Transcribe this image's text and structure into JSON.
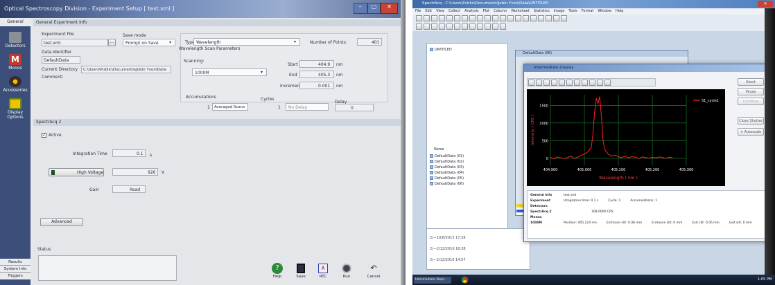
{
  "left": {
    "window_title": "Optical Spectroscopy Division - Experiment Setup [ test.xml ]",
    "window_controls": [
      "–",
      "▢",
      "✕"
    ],
    "side_tabs_top": "General",
    "side_items": [
      {
        "label": "Detectors",
        "icon": "detector-icon",
        "color": "#8b9098"
      },
      {
        "label": "Monos",
        "icon": "monochromator-icon",
        "color": "#c0392b"
      },
      {
        "label": "Accessories",
        "icon": "accessories-icon",
        "color": "#3d2a2a"
      },
      {
        "label": "Display Options",
        "icon": "display-options-icon",
        "color": "#6a8e1f"
      }
    ],
    "side_tabs_bottom": [
      "Results",
      "System Info",
      "Triggers"
    ],
    "section_general": "General Experiment Info",
    "experiment_file_label": "Experiment File",
    "experiment_file_value": "test.xml",
    "browse_label": "...",
    "save_mode_label": "Save mode",
    "save_mode_value": "Prompt on Save",
    "data_identifier_label": "Data Identifier",
    "data_identifier_value": "DefaultData",
    "current_directory_label": "Current Directory",
    "current_directory_value": "C:\\Users\\Public\\Documents\\Jobin Yvon\\Data",
    "comment_label": "Comment:",
    "type_label": "Type",
    "type_value": "Wavelength",
    "number_of_points_label": "Number of Points:",
    "number_of_points_value": "401",
    "wavelength_params_title": "Wavelength Scan Parameters",
    "scanning_label": "Scanning:",
    "scanning_value": "1000M",
    "start_label": "Start",
    "start_value": "404.9",
    "end_label": "End",
    "end_value": "405.3",
    "increment_label": "Increment",
    "increment_value": "0.001",
    "nm_unit": "nm",
    "accumulations_label": "Accumulations",
    "accumulations_count": "1",
    "accumulations_mode": "Averaged Scans",
    "cycles_label": "Cycles",
    "cycles_count": "1",
    "cycles_mode": "No Delay",
    "delay_label": "Delay",
    "delay_value": "0",
    "section_spectracq": "SpectrAcq 2",
    "active_label": "Active",
    "integration_time_label": "Integration Time",
    "integration_time_value": "0.1",
    "integration_time_unit": "s",
    "high_voltage_label": "High Voltage",
    "high_voltage_value": "926",
    "high_voltage_unit": "V",
    "gain_label": "Gain",
    "gain_value": "Read",
    "advanced_label": "Advanced",
    "status_label": "Status",
    "toolbar": [
      {
        "label": "Help",
        "icon": "help-icon"
      },
      {
        "label": "Save",
        "icon": "save-icon"
      },
      {
        "label": "RTC",
        "icon": "rtc-icon"
      },
      {
        "label": "Run",
        "icon": "run-icon"
      },
      {
        "label": "Cancel",
        "icon": "cancel-icon"
      }
    ]
  },
  "right": {
    "window_title": "SpectrAcq - C:\\Users\\Public\\Documents\\Jobin Yvon\\Data\\UNTITLED",
    "menu": [
      "File",
      "Edit",
      "View",
      "Collect",
      "Analysis",
      "Plot",
      "Column",
      "Worksheet",
      "Statistics",
      "Image",
      "Tools",
      "Format",
      "Window",
      "Help"
    ],
    "tree_root": "UNTITLED",
    "name_header": "Name",
    "tree_items": [
      "DefaultData (01)",
      "DefaultData (02)",
      "DefaultData (03)",
      "DefaultData (04)",
      "DefaultData (05)",
      "DefaultData (06)"
    ],
    "inner_window_title": "DefaultData (06)",
    "log_lines": [
      "2/—10/8/2015 17:28",
      "2/—2/12/2016 16:38",
      "2/—2/12/2016 14:57"
    ],
    "dialog_title": "Intermediate Display",
    "side_buttons": [
      "Abort",
      "Pause",
      "Continue",
      "Close Shutter",
      "Autoscale"
    ],
    "chart_info": [
      {
        "key": "General Info",
        "values": [
          "test.xml"
        ]
      },
      {
        "key": "Experiment",
        "values": [
          "Integration time: 0.1 s",
          "Cycle: 1",
          "Accumulations: 1"
        ]
      },
      {
        "key": "Detectors",
        "values": []
      },
      {
        "key": "SpectrAcq 2",
        "values": [
          "108.0000 CPS"
        ]
      },
      {
        "key": "Monos",
        "values": []
      },
      {
        "key": "1000M",
        "values": [
          "Position: 405.224 nm",
          "Entrance slit: 0.06 mm",
          "Entrance slit: 0 mm",
          "Exit slit: 0.06 mm",
          "Exit slit: 0 mm"
        ]
      }
    ],
    "taskbar_start": "Intermediate Displ...",
    "clock": "1:05 PM"
  },
  "chart_data": {
    "type": "line",
    "xlabel": "Wavelength ( nm )",
    "ylabel": "Intensity ( CPS )",
    "xlim": [
      404.9,
      405.3
    ],
    "ylim": [
      -200,
      1800
    ],
    "x_ticks": [
      "404.900",
      "405.000",
      "405.100",
      "405.200",
      "405.300"
    ],
    "y_ticks": [
      "0",
      "500",
      "1000",
      "1500"
    ],
    "series": [
      {
        "name": "S1_cycle1",
        "color": "#ff2020",
        "x": [
          404.9,
          404.91,
          404.92,
          404.93,
          404.94,
          404.95,
          404.96,
          404.97,
          404.98,
          404.99,
          405.0,
          405.01,
          405.02,
          405.025,
          405.03,
          405.035,
          405.04,
          405.045,
          405.05,
          405.055,
          405.06,
          405.07,
          405.08,
          405.09,
          405.1,
          405.11,
          405.12,
          405.13,
          405.14,
          405.15,
          405.16,
          405.17,
          405.18,
          405.19,
          405.2,
          405.21,
          405.22,
          405.23,
          405.24,
          405.25,
          405.26
        ],
        "values": [
          30,
          -20,
          40,
          10,
          -10,
          20,
          60,
          0,
          30,
          80,
          120,
          180,
          300,
          650,
          1300,
          1700,
          1550,
          1750,
          1200,
          500,
          250,
          120,
          60,
          90,
          40,
          20,
          60,
          10,
          50,
          30,
          -10,
          40,
          20,
          0,
          30,
          10,
          40,
          20,
          0,
          30,
          10
        ]
      }
    ],
    "grid": true,
    "legend_position": "top-right"
  }
}
